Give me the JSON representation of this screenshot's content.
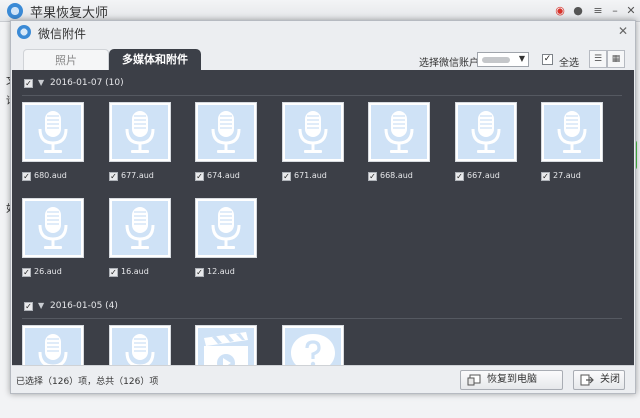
{
  "app": {
    "title": "苹果恢复大师",
    "icons": [
      "weibo-icon",
      "chat-icon",
      "menu-icon",
      "minimize-icon",
      "close-icon"
    ],
    "behind_letters": [
      "文",
      "请",
      "如"
    ]
  },
  "dialog": {
    "title": "微信附件",
    "close_symbol": "✕",
    "tabs": [
      {
        "label": "照片",
        "active": false
      },
      {
        "label": "多媒体和附件",
        "active": true
      }
    ],
    "account_label": "选择微信账户",
    "select_all_label": "全选",
    "select_all_checked": true
  },
  "groups": [
    {
      "date": "2016-01-07",
      "count_text": "(10)",
      "checked": true,
      "items": [
        {
          "name": "680.aud",
          "kind": "audio",
          "checked": true
        },
        {
          "name": "677.aud",
          "kind": "audio",
          "checked": true
        },
        {
          "name": "674.aud",
          "kind": "audio",
          "checked": true
        },
        {
          "name": "671.aud",
          "kind": "audio",
          "checked": true
        },
        {
          "name": "668.aud",
          "kind": "audio",
          "checked": true
        },
        {
          "name": "667.aud",
          "kind": "audio",
          "checked": true
        },
        {
          "name": "27.aud",
          "kind": "audio",
          "checked": true
        },
        {
          "name": "26.aud",
          "kind": "audio",
          "checked": true
        },
        {
          "name": "16.aud",
          "kind": "audio",
          "checked": true
        },
        {
          "name": "12.aud",
          "kind": "audio",
          "checked": true
        }
      ]
    },
    {
      "date": "2016-01-05",
      "count_text": "(4)",
      "checked": true,
      "items": [
        {
          "name": "",
          "kind": "audio",
          "checked": true
        },
        {
          "name": "",
          "kind": "audio",
          "checked": true
        },
        {
          "name": "",
          "kind": "video",
          "checked": true
        },
        {
          "name": "",
          "kind": "unknown",
          "checked": true
        }
      ]
    }
  ],
  "status": {
    "text": "已选择（126）项，总共（126）项",
    "restore_label": "恢复到电脑",
    "close_label": "关闭"
  },
  "colors": {
    "content_bg": "#3c3f47",
    "thumb_bg": "#cfe2f6",
    "icon_fill": "#ffffff"
  }
}
